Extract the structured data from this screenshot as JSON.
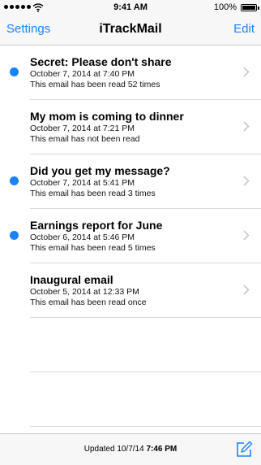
{
  "status_bar": {
    "time": "9:41 AM",
    "battery_percent": "100%"
  },
  "nav": {
    "left_label": "Settings",
    "title": "iTrackMail",
    "right_label": "Edit"
  },
  "emails": [
    {
      "subject": "Secret: Please don't share",
      "date": "October 7, 2014 at 7:40 PM",
      "reads": "This email has been read 52 times",
      "unread": true
    },
    {
      "subject": "My mom is coming to dinner",
      "date": "October 7, 2014 at 7:21 PM",
      "reads": "This email has not been read",
      "unread": false
    },
    {
      "subject": "Did you get my message?",
      "date": "October 7, 2014 at 5:41 PM",
      "reads": "This email has been read 3 times",
      "unread": true
    },
    {
      "subject": "Earnings report for June",
      "date": "October 6, 2014 at 5:46 PM",
      "reads": "This email has been read 5 times",
      "unread": true
    },
    {
      "subject": "Inaugural email",
      "date": "October 5, 2014 at 12:33 PM",
      "reads": "This email has been read once",
      "unread": false
    }
  ],
  "toolbar": {
    "updated_label": "Updated",
    "updated_date": "10/7/14",
    "updated_time": "7:46 PM",
    "compose_icon": "compose-icon"
  },
  "colors": {
    "accent": "#1a82fb",
    "bar_background": "#f7f7f8",
    "separator": "#d9d9de"
  }
}
